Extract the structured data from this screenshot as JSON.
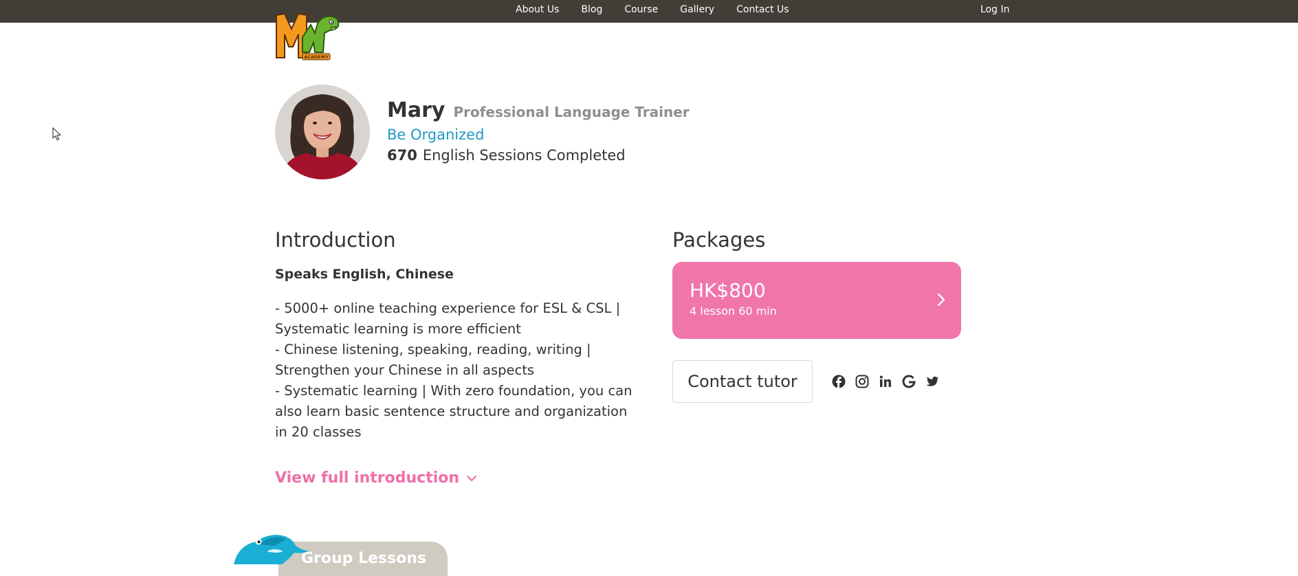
{
  "nav": {
    "items": [
      "About Us",
      "Blog",
      "Course",
      "Gallery",
      "Contact Us"
    ],
    "login": "Log In"
  },
  "logo": {
    "text": "ACADEMY"
  },
  "profile": {
    "name": "Mary",
    "title": "Professional Language Trainer",
    "motto": "Be Organized",
    "session_count": "670",
    "session_label": "English Sessions Completed"
  },
  "intro": {
    "heading": "Introduction",
    "speaks": "Speaks English, Chinese",
    "lines": [
      "- 5000+ online teaching experience for ESL & CSL |",
      "Systematic learning is more efficient",
      "- Chinese listening, speaking, reading, writing |",
      "Strengthen your Chinese in all aspects",
      "- Systematic learning | With zero foundation, you can",
      "also learn basic sentence structure and organization",
      "in 20 classes"
    ],
    "view_full": "View full introduction"
  },
  "packages": {
    "heading": "Packages",
    "items": [
      {
        "price": "HK$800",
        "detail": "4 lesson 60 min"
      }
    ]
  },
  "contact": {
    "label": "Contact tutor"
  },
  "socials": [
    "facebook-icon",
    "instagram-icon",
    "linkedin-icon",
    "google-icon",
    "twitter-icon"
  ],
  "group": {
    "label": "Group Lessons"
  },
  "colors": {
    "topbar": "#423d36",
    "accent_pink": "#f075ab",
    "accent_blue": "#1f9bc2",
    "muted": "#8e8e8e"
  }
}
